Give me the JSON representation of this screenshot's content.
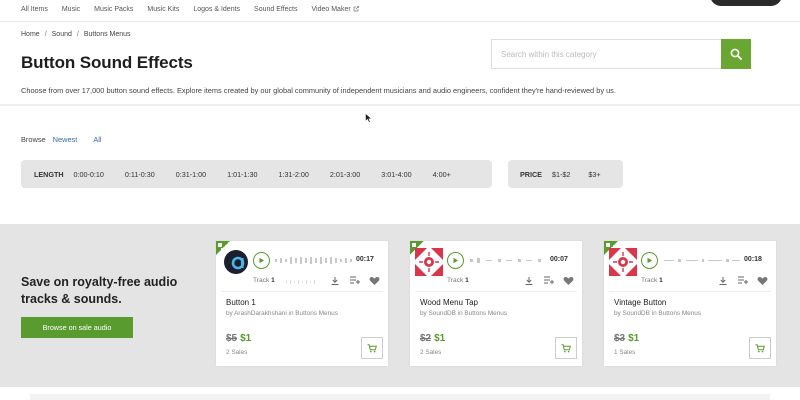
{
  "nav": {
    "items": [
      "All Items",
      "Music",
      "Music Packs",
      "Music Kits",
      "Logos & Idents",
      "Sound Effects",
      "Video Maker"
    ]
  },
  "breadcrumb": [
    "Home",
    "Sound",
    "Buttons Menus"
  ],
  "page": {
    "title": "Button Sound Effects",
    "description": "Choose from over 17,000 button sound effects. Explore items created by our global community of independent musicians and audio engineers, confident they're hand-reviewed by us."
  },
  "search": {
    "placeholder": "Search within this category",
    "value": ""
  },
  "browse": {
    "label": "Browse",
    "options": [
      "Newest",
      "All"
    ]
  },
  "filters": {
    "length": {
      "label": "LENGTH",
      "options": [
        "0:00-0:10",
        "0:11-0:30",
        "0:31-1:00",
        "1:01-1:30",
        "1:31-2:00",
        "2:01-3:00",
        "3:01-4:00",
        "4:00+"
      ]
    },
    "price": {
      "label": "PRICE",
      "options": [
        "$1-$2",
        "$3+"
      ]
    }
  },
  "promo": {
    "title": "Save on royalty-free audio tracks & sounds.",
    "button": "Browse on sale audio"
  },
  "cards": [
    {
      "title": "Button 1",
      "author": "by ArashDarakhshani in Buttons Menus",
      "duration": "00:17",
      "track_label": "Track",
      "track_num": "1",
      "old_price": "$5",
      "new_price": "$1",
      "sales": "2 Sales",
      "thumb": "avatar"
    },
    {
      "title": "Wood Menu Tap",
      "author": "by SoundDB in Buttons Menus",
      "duration": "00:07",
      "track_label": "Track",
      "track_num": "1",
      "old_price": "$2",
      "new_price": "$1",
      "sales": "2 Sales",
      "thumb": "pattern"
    },
    {
      "title": "Vintage Button",
      "author": "by SoundDB in Buttons Menus",
      "duration": "00:18",
      "track_label": "Track",
      "track_num": "1",
      "old_price": "$3",
      "new_price": "$1",
      "sales": "1 Sales",
      "thumb": "pattern"
    }
  ],
  "colors": {
    "accent": "#6aa632",
    "promo_bg": "#e4e4e4",
    "filter_bg": "#e5e5e5",
    "thumb_red": "#d9364a"
  }
}
